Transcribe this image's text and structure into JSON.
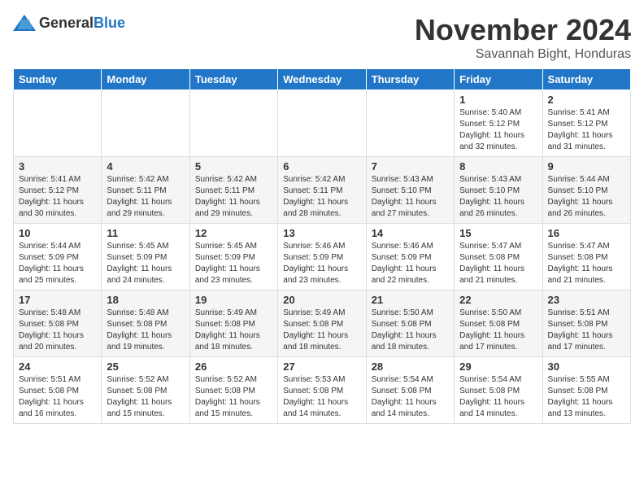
{
  "header": {
    "logo_general": "General",
    "logo_blue": "Blue",
    "month_title": "November 2024",
    "subtitle": "Savannah Bight, Honduras"
  },
  "days_of_week": [
    "Sunday",
    "Monday",
    "Tuesday",
    "Wednesday",
    "Thursday",
    "Friday",
    "Saturday"
  ],
  "weeks": [
    [
      {
        "day": "",
        "info": ""
      },
      {
        "day": "",
        "info": ""
      },
      {
        "day": "",
        "info": ""
      },
      {
        "day": "",
        "info": ""
      },
      {
        "day": "",
        "info": ""
      },
      {
        "day": "1",
        "info": "Sunrise: 5:40 AM\nSunset: 5:12 PM\nDaylight: 11 hours\nand 32 minutes."
      },
      {
        "day": "2",
        "info": "Sunrise: 5:41 AM\nSunset: 5:12 PM\nDaylight: 11 hours\nand 31 minutes."
      }
    ],
    [
      {
        "day": "3",
        "info": "Sunrise: 5:41 AM\nSunset: 5:12 PM\nDaylight: 11 hours\nand 30 minutes."
      },
      {
        "day": "4",
        "info": "Sunrise: 5:42 AM\nSunset: 5:11 PM\nDaylight: 11 hours\nand 29 minutes."
      },
      {
        "day": "5",
        "info": "Sunrise: 5:42 AM\nSunset: 5:11 PM\nDaylight: 11 hours\nand 29 minutes."
      },
      {
        "day": "6",
        "info": "Sunrise: 5:42 AM\nSunset: 5:11 PM\nDaylight: 11 hours\nand 28 minutes."
      },
      {
        "day": "7",
        "info": "Sunrise: 5:43 AM\nSunset: 5:10 PM\nDaylight: 11 hours\nand 27 minutes."
      },
      {
        "day": "8",
        "info": "Sunrise: 5:43 AM\nSunset: 5:10 PM\nDaylight: 11 hours\nand 26 minutes."
      },
      {
        "day": "9",
        "info": "Sunrise: 5:44 AM\nSunset: 5:10 PM\nDaylight: 11 hours\nand 26 minutes."
      }
    ],
    [
      {
        "day": "10",
        "info": "Sunrise: 5:44 AM\nSunset: 5:09 PM\nDaylight: 11 hours\nand 25 minutes."
      },
      {
        "day": "11",
        "info": "Sunrise: 5:45 AM\nSunset: 5:09 PM\nDaylight: 11 hours\nand 24 minutes."
      },
      {
        "day": "12",
        "info": "Sunrise: 5:45 AM\nSunset: 5:09 PM\nDaylight: 11 hours\nand 23 minutes."
      },
      {
        "day": "13",
        "info": "Sunrise: 5:46 AM\nSunset: 5:09 PM\nDaylight: 11 hours\nand 23 minutes."
      },
      {
        "day": "14",
        "info": "Sunrise: 5:46 AM\nSunset: 5:09 PM\nDaylight: 11 hours\nand 22 minutes."
      },
      {
        "day": "15",
        "info": "Sunrise: 5:47 AM\nSunset: 5:08 PM\nDaylight: 11 hours\nand 21 minutes."
      },
      {
        "day": "16",
        "info": "Sunrise: 5:47 AM\nSunset: 5:08 PM\nDaylight: 11 hours\nand 21 minutes."
      }
    ],
    [
      {
        "day": "17",
        "info": "Sunrise: 5:48 AM\nSunset: 5:08 PM\nDaylight: 11 hours\nand 20 minutes."
      },
      {
        "day": "18",
        "info": "Sunrise: 5:48 AM\nSunset: 5:08 PM\nDaylight: 11 hours\nand 19 minutes."
      },
      {
        "day": "19",
        "info": "Sunrise: 5:49 AM\nSunset: 5:08 PM\nDaylight: 11 hours\nand 18 minutes."
      },
      {
        "day": "20",
        "info": "Sunrise: 5:49 AM\nSunset: 5:08 PM\nDaylight: 11 hours\nand 18 minutes."
      },
      {
        "day": "21",
        "info": "Sunrise: 5:50 AM\nSunset: 5:08 PM\nDaylight: 11 hours\nand 18 minutes."
      },
      {
        "day": "22",
        "info": "Sunrise: 5:50 AM\nSunset: 5:08 PM\nDaylight: 11 hours\nand 17 minutes."
      },
      {
        "day": "23",
        "info": "Sunrise: 5:51 AM\nSunset: 5:08 PM\nDaylight: 11 hours\nand 17 minutes."
      }
    ],
    [
      {
        "day": "24",
        "info": "Sunrise: 5:51 AM\nSunset: 5:08 PM\nDaylight: 11 hours\nand 16 minutes."
      },
      {
        "day": "25",
        "info": "Sunrise: 5:52 AM\nSunset: 5:08 PM\nDaylight: 11 hours\nand 15 minutes."
      },
      {
        "day": "26",
        "info": "Sunrise: 5:52 AM\nSunset: 5:08 PM\nDaylight: 11 hours\nand 15 minutes."
      },
      {
        "day": "27",
        "info": "Sunrise: 5:53 AM\nSunset: 5:08 PM\nDaylight: 11 hours\nand 14 minutes."
      },
      {
        "day": "28",
        "info": "Sunrise: 5:54 AM\nSunset: 5:08 PM\nDaylight: 11 hours\nand 14 minutes."
      },
      {
        "day": "29",
        "info": "Sunrise: 5:54 AM\nSunset: 5:08 PM\nDaylight: 11 hours\nand 14 minutes."
      },
      {
        "day": "30",
        "info": "Sunrise: 5:55 AM\nSunset: 5:08 PM\nDaylight: 11 hours\nand 13 minutes."
      }
    ]
  ]
}
